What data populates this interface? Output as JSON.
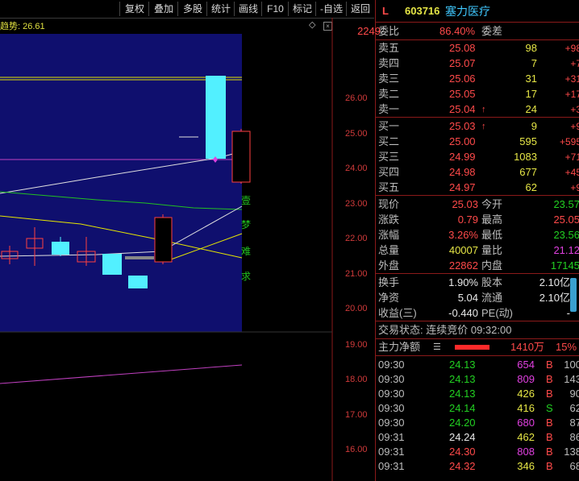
{
  "toolbar": {
    "buttons": [
      "复权",
      "叠加",
      "多股",
      "统计",
      "画线",
      "F10",
      "标记",
      "-自选",
      "返回"
    ]
  },
  "chart": {
    "trend_label": "趋势: 26.61",
    "price_ticks": [
      "26.00",
      "25.00",
      "24.00",
      "23.00",
      "22.00",
      "21.00",
      "20.00",
      "19.00",
      "18.00",
      "17.00",
      "16.00"
    ],
    "vertical_text": [
      "壹",
      "梦",
      "难",
      "求"
    ]
  },
  "quote": {
    "header": {
      "market": "L",
      "code": "603716",
      "name": "塞力医疗"
    },
    "weibi": {
      "label": "委比",
      "value": "86.40%",
      "label2": "委差",
      "value2": "2249"
    },
    "asks": [
      {
        "label": "卖五",
        "price": "25.08",
        "vol": "98",
        "chg": "+98"
      },
      {
        "label": "卖四",
        "price": "25.07",
        "vol": "7",
        "chg": "+7"
      },
      {
        "label": "卖三",
        "price": "25.06",
        "vol": "31",
        "chg": "+31"
      },
      {
        "label": "卖二",
        "price": "25.05",
        "vol": "17",
        "chg": "+17"
      },
      {
        "label": "卖一",
        "price": "25.04",
        "vol": "24",
        "chg": "+3"
      }
    ],
    "bids": [
      {
        "label": "买一",
        "price": "25.03",
        "vol": "9",
        "chg": "+9"
      },
      {
        "label": "买二",
        "price": "25.00",
        "vol": "595",
        "chg": "+595"
      },
      {
        "label": "买三",
        "price": "24.99",
        "vol": "1083",
        "chg": "+71"
      },
      {
        "label": "买四",
        "price": "24.98",
        "vol": "677",
        "chg": "+45"
      },
      {
        "label": "买五",
        "price": "24.97",
        "vol": "62",
        "chg": "+9"
      }
    ],
    "stats": [
      {
        "l1": "现价",
        "v1": "25.03",
        "l2": "今开",
        "v2": "23.57"
      },
      {
        "l1": "涨跌",
        "v1": "0.79",
        "l2": "最高",
        "v2": "25.05"
      },
      {
        "l1": "涨幅",
        "v1": "3.26%",
        "l2": "最低",
        "v2": "23.56"
      },
      {
        "l1": "总量",
        "v1": "40007",
        "l2": "量比",
        "v2": "21.12"
      },
      {
        "l1": "外盘",
        "v1": "22862",
        "l2": "内盘",
        "v2": "17145"
      }
    ],
    "stats2": [
      {
        "l1": "换手",
        "v1": "1.90%",
        "l2": "股本",
        "v2": "2.10亿"
      },
      {
        "l1": "净资",
        "v1": "5.04",
        "l2": "流通",
        "v2": "2.10亿"
      },
      {
        "l1": "收益(三)",
        "v1": "-0.440",
        "l2": "PE(动)",
        "v2": "-"
      }
    ],
    "trade_status": "交易状态: 连续竞价 09:32:00",
    "main_flow": {
      "label": "主力净额",
      "value": "1410万",
      "pct": "15%"
    },
    "ticks": [
      {
        "time": "09:30",
        "price": "24.13",
        "vol": "654",
        "bs": "B",
        "n": "100"
      },
      {
        "time": "09:30",
        "price": "24.13",
        "vol": "809",
        "bs": "B",
        "n": "143"
      },
      {
        "time": "09:30",
        "price": "24.13",
        "vol": "426",
        "bs": "B",
        "n": "90"
      },
      {
        "time": "09:30",
        "price": "24.14",
        "vol": "416",
        "bs": "S",
        "n": "62"
      },
      {
        "time": "09:30",
        "price": "24.20",
        "vol": "680",
        "bs": "B",
        "n": "87"
      },
      {
        "time": "09:31",
        "price": "24.24",
        "vol": "462",
        "bs": "B",
        "n": "86"
      },
      {
        "time": "09:31",
        "price": "24.30",
        "vol": "808",
        "bs": "B",
        "n": "138"
      },
      {
        "time": "09:31",
        "price": "24.32",
        "vol": "346",
        "bs": "B",
        "n": "68"
      }
    ]
  }
}
